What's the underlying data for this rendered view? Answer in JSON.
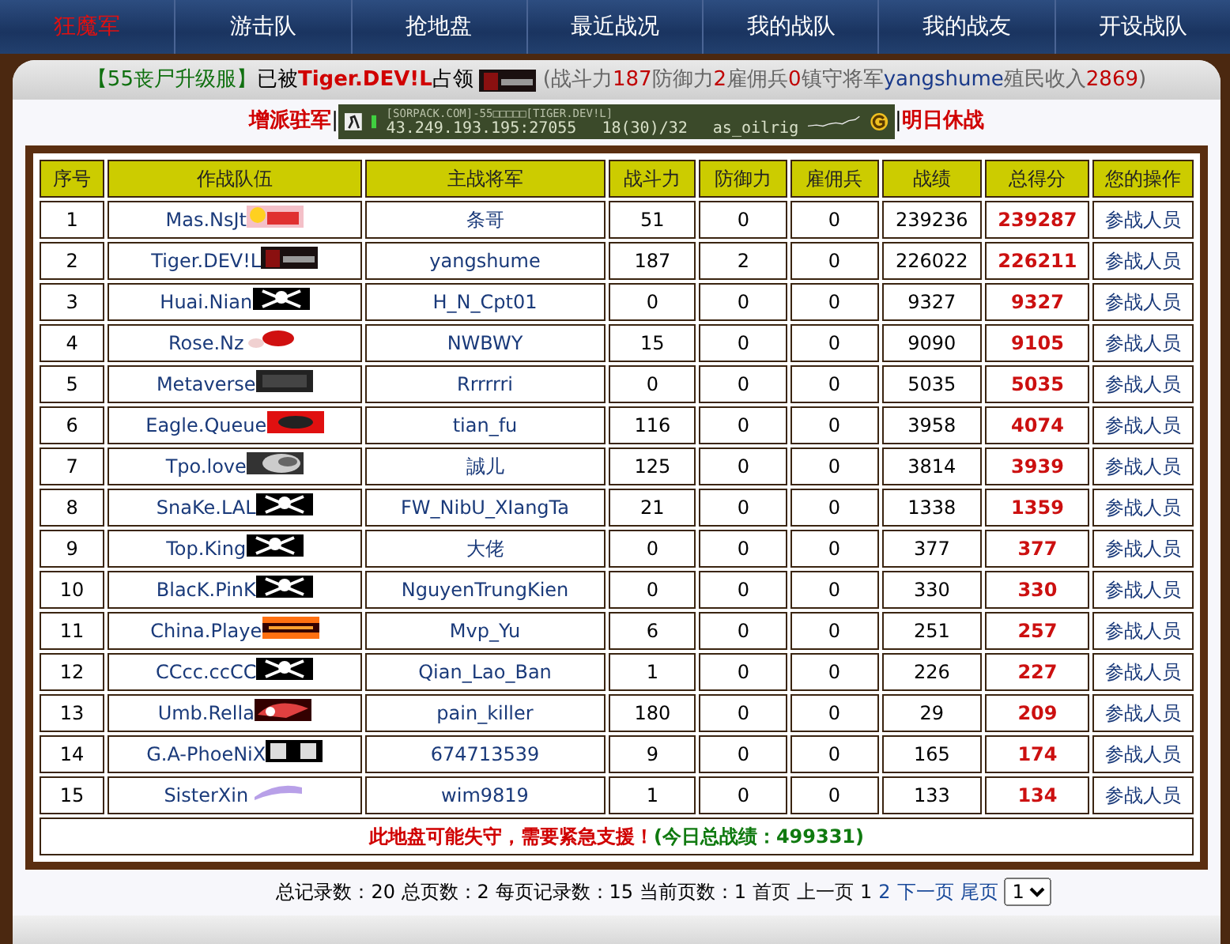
{
  "nav": [
    {
      "label": "狂魔军",
      "selected": true
    },
    {
      "label": "游击队",
      "selected": false
    },
    {
      "label": "抢地盘",
      "selected": false
    },
    {
      "label": "最近战况",
      "selected": false
    },
    {
      "label": "我的战队",
      "selected": false
    },
    {
      "label": "我的战友",
      "selected": false
    },
    {
      "label": "开设战队",
      "selected": false
    }
  ],
  "occupation": [
    {
      "kind": "server",
      "text": "【55丧尸升级服】"
    },
    {
      "kind": "plain",
      "text": "已被"
    },
    {
      "kind": "team",
      "text": "Tiger.DEV!L"
    },
    {
      "kind": "plain",
      "text": "占领"
    },
    {
      "kind": "logo"
    },
    {
      "kind": "muted",
      "text": "(战斗力"
    },
    {
      "kind": "number",
      "text": "187"
    },
    {
      "kind": "muted",
      "text": " 防御力"
    },
    {
      "kind": "number",
      "text": "2"
    },
    {
      "kind": "muted",
      "text": " 雇佣兵"
    },
    {
      "kind": "number",
      "text": "0"
    },
    {
      "kind": "muted",
      "text": " 镇守将军"
    },
    {
      "kind": "general",
      "text": "yangshume"
    },
    {
      "kind": "muted",
      "text": " 殖民收入"
    },
    {
      "kind": "number",
      "text": "2869"
    },
    {
      "kind": "muted",
      "text": ")"
    }
  ],
  "actions": [
    {
      "label": "增派驻军"
    },
    {
      "label": "明日休战"
    }
  ],
  "separator": "|",
  "server_banner": {
    "title": "[SORPACK.COM]-55□□□□□[TIGER.DEV!L]",
    "address": "43.249.193.195:27055",
    "players": "18(30)/32",
    "map": "as_oilrig"
  },
  "table": {
    "columns": [
      "序号",
      "作战队伍",
      "主战将军",
      "战斗力",
      "防御力",
      "雇佣兵",
      "战绩",
      "总得分",
      "您的操作"
    ],
    "rows": [
      {
        "rank": "1",
        "team": "Mas.NsJt",
        "general": "条哥",
        "attack": "51",
        "defense": "0",
        "mercenaries": "0",
        "record": "239236",
        "score": "239287",
        "action": "参战人员"
      },
      {
        "rank": "2",
        "team": "Tiger.DEV!L",
        "general": "yangshume",
        "attack": "187",
        "defense": "2",
        "mercenaries": "0",
        "record": "226022",
        "score": "226211",
        "action": "参战人员"
      },
      {
        "rank": "3",
        "team": "Huai.Nian",
        "general": "H_N_Cpt01",
        "attack": "0",
        "defense": "0",
        "mercenaries": "0",
        "record": "9327",
        "score": "9327",
        "action": "参战人员"
      },
      {
        "rank": "4",
        "team": "Rose.Nz",
        "general": "NWBWY",
        "attack": "15",
        "defense": "0",
        "mercenaries": "0",
        "record": "9090",
        "score": "9105",
        "action": "参战人员"
      },
      {
        "rank": "5",
        "team": "Metaverse",
        "general": "Rrrrrri",
        "attack": "0",
        "defense": "0",
        "mercenaries": "0",
        "record": "5035",
        "score": "5035",
        "action": "参战人员"
      },
      {
        "rank": "6",
        "team": "Eagle.Queue",
        "general": "tian_fu",
        "attack": "116",
        "defense": "0",
        "mercenaries": "0",
        "record": "3958",
        "score": "4074",
        "action": "参战人员"
      },
      {
        "rank": "7",
        "team": "Tpo.love",
        "general": "誠儿",
        "attack": "125",
        "defense": "0",
        "mercenaries": "0",
        "record": "3814",
        "score": "3939",
        "action": "参战人员"
      },
      {
        "rank": "8",
        "team": "SnaKe.LAL",
        "general": "FW_NibU_XIangTa",
        "attack": "21",
        "defense": "0",
        "mercenaries": "0",
        "record": "1338",
        "score": "1359",
        "action": "参战人员"
      },
      {
        "rank": "9",
        "team": "Top.King",
        "general": "大佬",
        "attack": "0",
        "defense": "0",
        "mercenaries": "0",
        "record": "377",
        "score": "377",
        "action": "参战人员"
      },
      {
        "rank": "10",
        "team": "BlacK.PinK",
        "general": "NguyenTrungKien",
        "attack": "0",
        "defense": "0",
        "mercenaries": "0",
        "record": "330",
        "score": "330",
        "action": "参战人员"
      },
      {
        "rank": "11",
        "team": "China.Playe",
        "general": "Mvp_Yu",
        "attack": "6",
        "defense": "0",
        "mercenaries": "0",
        "record": "251",
        "score": "257",
        "action": "参战人员"
      },
      {
        "rank": "12",
        "team": "CCcc.ccCC",
        "general": "Qian_Lao_Ban",
        "attack": "1",
        "defense": "0",
        "mercenaries": "0",
        "record": "226",
        "score": "227",
        "action": "参战人员"
      },
      {
        "rank": "13",
        "team": "Umb.Rella",
        "general": "pain_killer",
        "attack": "180",
        "defense": "0",
        "mercenaries": "0",
        "record": "29",
        "score": "209",
        "action": "参战人员"
      },
      {
        "rank": "14",
        "team": "G.A-PhoeNiX",
        "general": "674713539",
        "attack": "9",
        "defense": "0",
        "mercenaries": "0",
        "record": "165",
        "score": "174",
        "action": "参战人员"
      },
      {
        "rank": "15",
        "team": "SisterXin",
        "general": "wim9819",
        "attack": "1",
        "defense": "0",
        "mercenaries": "0",
        "record": "133",
        "score": "134",
        "action": "参战人员"
      }
    ],
    "alert": "此地盘可能失守，需要紧急支援！",
    "daily_total": "(今日总战绩：499331)"
  },
  "pager": {
    "summary": "总记录数：20 总页数：2 每页记录数：15 当前页数：1",
    "links": [
      {
        "label": "首页",
        "disabled": true
      },
      {
        "label": "上一页",
        "disabled": true
      },
      {
        "label": "1",
        "disabled": true
      },
      {
        "label": "2",
        "disabled": false
      },
      {
        "label": "下一页",
        "disabled": false
      },
      {
        "label": "尾页",
        "disabled": false
      }
    ],
    "page_select": "1"
  }
}
